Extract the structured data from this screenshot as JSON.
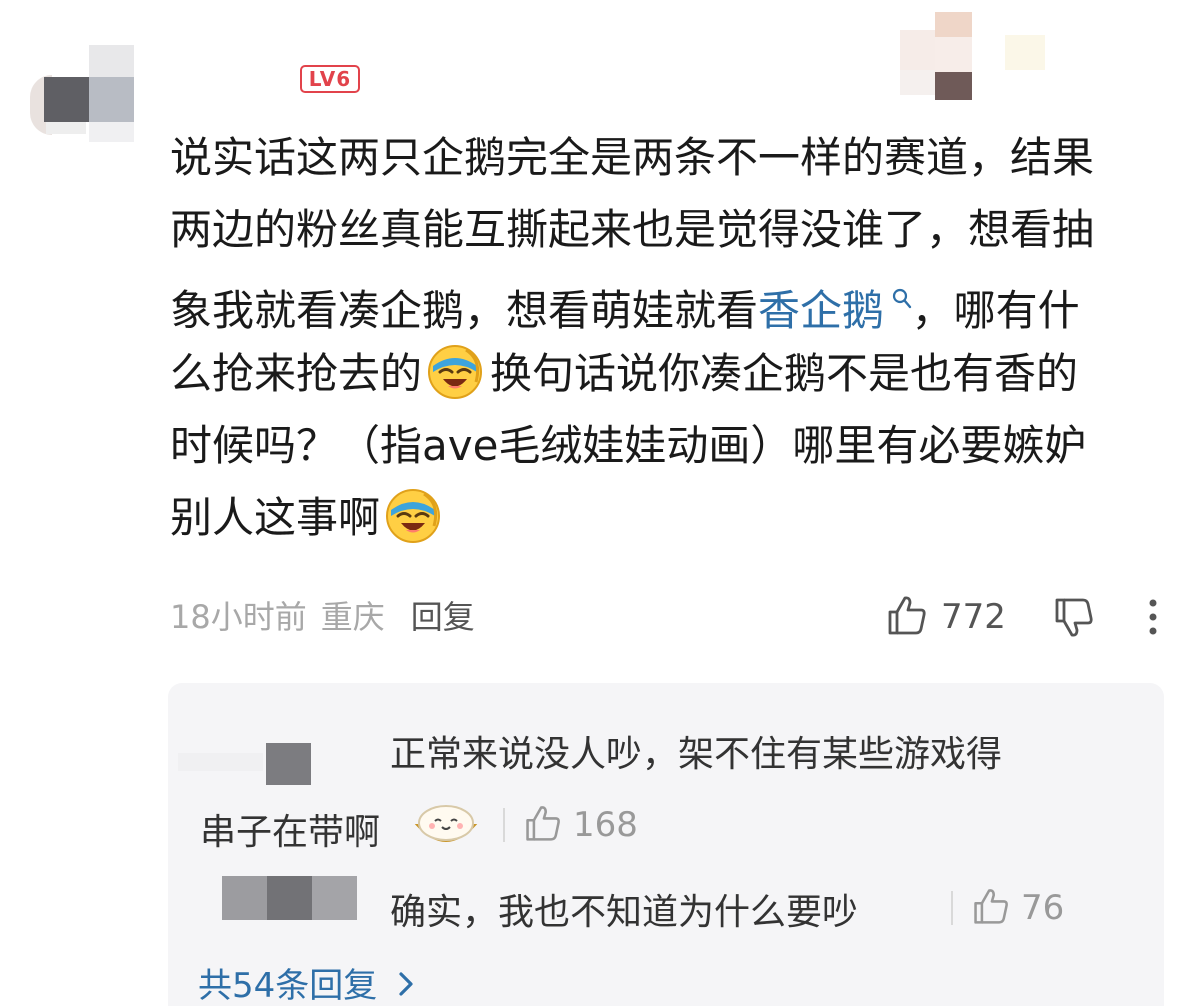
{
  "comment": {
    "level_badge": "LV6",
    "lines": [
      [
        "说实话这两只企鹅完全是两条不一样的赛道，结果"
      ],
      [
        "两边的粉丝真能互撕起来也是觉得没谁了，想看抽"
      ],
      [
        "象我就看凑企鹅，想看萌娃就看",
        "香企鹅",
        "，哪有什"
      ],
      [
        "么抢来抢去的",
        "换句话说你凑企鹅不是也有香的"
      ],
      [
        "时候吗？（指ave毛绒娃娃动画）哪里有必要嫉妒"
      ],
      [
        "别人这事啊"
      ]
    ],
    "topic_link": "香企鹅",
    "time": "18小时前",
    "location": "重庆",
    "reply_label": "回复",
    "like_count": "772",
    "emoji_name": "laughing-cry-emoji"
  },
  "replies": [
    {
      "line1": "正常来说没人吵，架不住有某些游戏得",
      "line2": "串子在带啊",
      "emoji_name": "dumpling-smile-emoji",
      "like_count": "168"
    },
    {
      "text": "确实，我也不知道为什么要吵",
      "like_count": "76"
    }
  ],
  "more_replies_label": "共54条回复",
  "colors": {
    "link": "#2e6fa8",
    "badge": "#e2434b",
    "meta_gray": "#a8a8a8",
    "reply_bg": "#f5f5f7"
  }
}
